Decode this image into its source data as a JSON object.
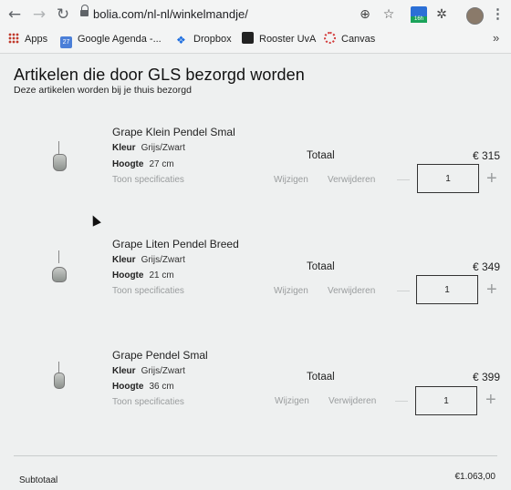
{
  "browser": {
    "url": "bolia.com/nl-nl/winkelmandje/",
    "badge": "16h",
    "bookmarks": [
      {
        "label": "Apps"
      },
      {
        "label": "Google Agenda -..."
      },
      {
        "label": "Dropbox"
      },
      {
        "label": "Rooster UvA"
      },
      {
        "label": "Canvas"
      }
    ],
    "calendar_day": "27"
  },
  "page": {
    "title": "Artikelen die door GLS bezorgd worden",
    "subtitle": "Deze artikelen worden bij je thuis bezorgd",
    "items": [
      {
        "name": "Grape Klein Pendel Smal",
        "color_label": "Kleur",
        "color": "Grijs/Zwart",
        "height_label": "Hoogte",
        "height": "27 cm",
        "specs": "Toon specificaties",
        "edit": "Wijzigen",
        "remove": "Verwijderen",
        "total_label": "Totaal",
        "price": "€ 315",
        "qty": "1"
      },
      {
        "name": "Grape Liten Pendel Breed",
        "color_label": "Kleur",
        "color": "Grijs/Zwart",
        "height_label": "Hoogte",
        "height": "21 cm",
        "specs": "Toon specificaties",
        "edit": "Wijzigen",
        "remove": "Verwijderen",
        "total_label": "Totaal",
        "price": "€ 349",
        "qty": "1"
      },
      {
        "name": "Grape Pendel Smal",
        "color_label": "Kleur",
        "color": "Grijs/Zwart",
        "height_label": "Hoogte",
        "height": "36 cm",
        "specs": "Toon specificaties",
        "edit": "Wijzigen",
        "remove": "Verwijderen",
        "total_label": "Totaal",
        "price": "€ 399",
        "qty": "1"
      }
    ],
    "subtotal_label": "Subtotaal",
    "subtotal_value": "€1.063,00"
  },
  "colors": {
    "background": "#eef0f0",
    "muted_text": "#9a9d9e",
    "text": "#222222"
  }
}
